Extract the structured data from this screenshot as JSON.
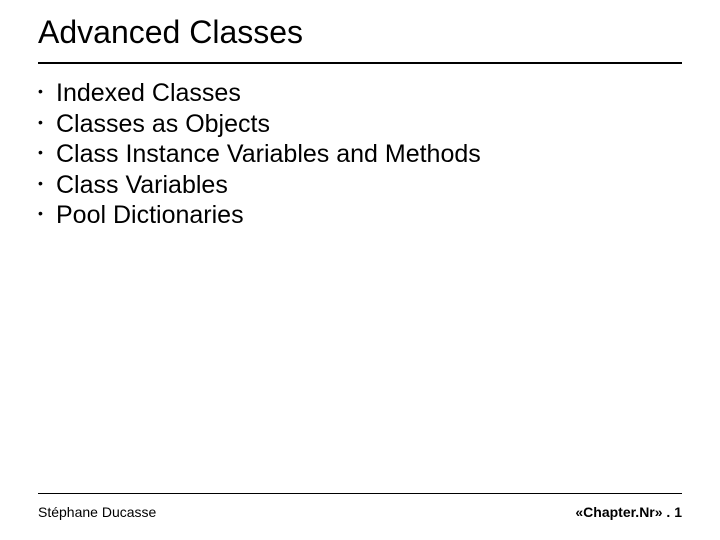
{
  "title": "Advanced Classes",
  "bullets": [
    "Indexed Classes",
    "Classes as Objects",
    "Class Instance Variables and Methods",
    "Class Variables",
    "Pool Dictionaries"
  ],
  "footer": {
    "author": "Stéphane Ducasse",
    "page_ref": "«Chapter.Nr» . 1"
  }
}
